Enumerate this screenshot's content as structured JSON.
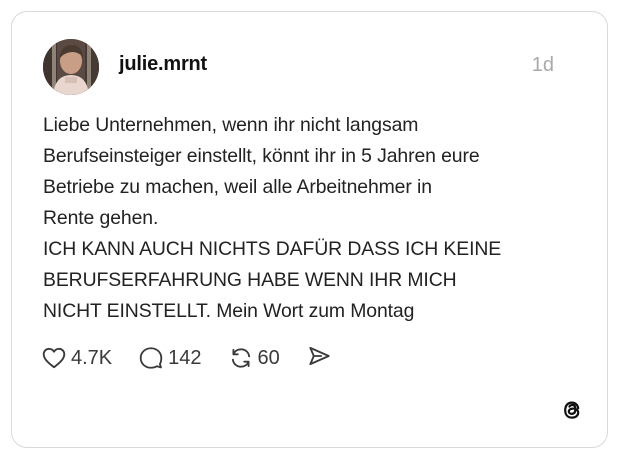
{
  "post": {
    "username": "julie.mrnt",
    "timestamp": "1d",
    "text_lines": [
      "Liebe Unternehmen, wenn ihr nicht langsam",
      "Berufseinsteiger einstellt, könnt ihr in 5 Jahren eure",
      "Betriebe zu machen, weil alle Arbeitnehmer in",
      "Rente gehen.",
      "ICH KANN AUCH NICHTS DAFÜR DASS ICH KEINE",
      "BERUFSERFAHRUNG HABE WENN IHR MICH",
      "NICHT EINSTELLT. Mein Wort zum Montag"
    ]
  },
  "actions": {
    "likes": "4.7K",
    "replies": "142",
    "reposts": "60"
  },
  "icons": {
    "like": "heart-icon",
    "reply": "speech-bubble-icon",
    "repost": "repost-icon",
    "share": "send-icon",
    "brand": "threads-logo-icon"
  }
}
